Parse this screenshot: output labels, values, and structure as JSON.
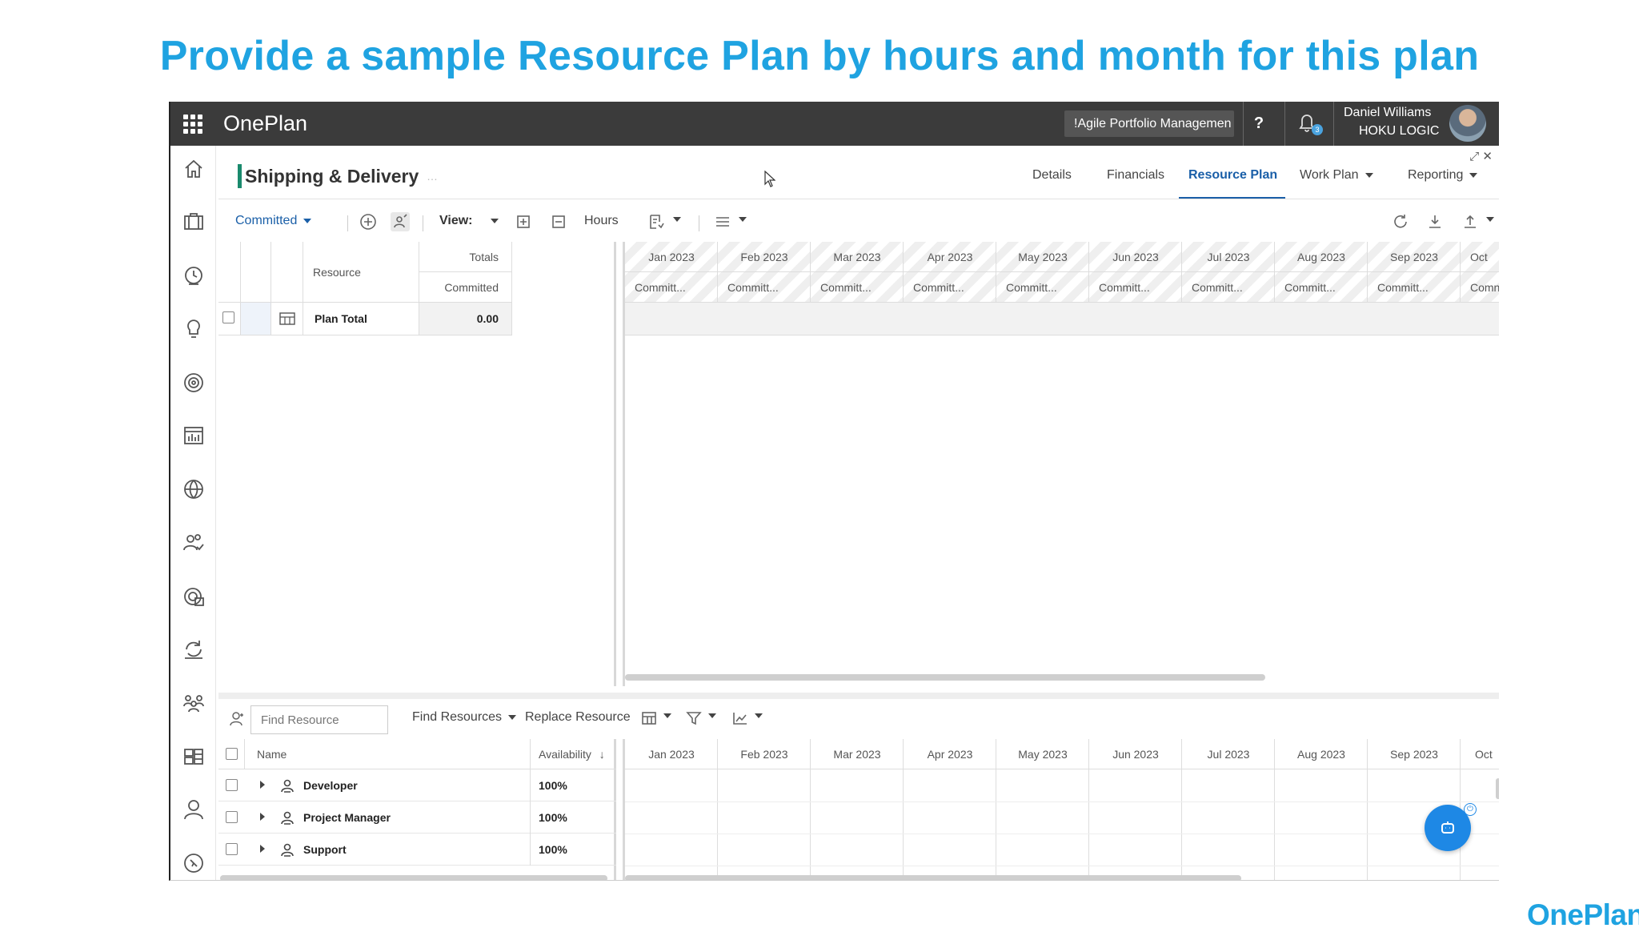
{
  "slide": {
    "title": "Provide a sample Resource Plan by hours and month for this plan",
    "footer_logo": "OnePlan"
  },
  "topbar": {
    "brand": "OnePlan",
    "portfolio": "!Agile Portfolio Managemen",
    "help": "?",
    "notifications_count": "3",
    "user_name": "Daniel Williams",
    "user_org": "HOKU LOGIC"
  },
  "sidenav": {
    "items": [
      "home-icon",
      "portfolio-icon",
      "timesheet-icon",
      "ideas-icon",
      "goals-icon",
      "reports-icon",
      "globe-icon",
      "resources-icon",
      "analytics-icon",
      "cycle-icon",
      "teams-icon",
      "boards-icon",
      "profile-icon",
      "compass-icon"
    ]
  },
  "project": {
    "title": "Shipping & Delivery",
    "dots": "…"
  },
  "tabs": {
    "details": "Details",
    "financials": "Financials",
    "resource_plan": "Resource Plan",
    "work_plan": "Work Plan",
    "reporting": "Reporting"
  },
  "toolbar": {
    "committed": "Committed",
    "view_label": "View:",
    "hours": "Hours"
  },
  "grid": {
    "resource_header": "Resource",
    "totals_header": "Totals",
    "committed_header": "Committed",
    "plan_total_label": "Plan Total",
    "plan_total_value": "0.00",
    "months": [
      "Jan 2023",
      "Feb 2023",
      "Mar 2023",
      "Apr 2023",
      "May 2023",
      "Jun 2023",
      "Jul 2023",
      "Aug 2023",
      "Sep 2023",
      "Oct"
    ],
    "month_sub": [
      "Committ...",
      "Committ...",
      "Committ...",
      "Committ...",
      "Committ...",
      "Committ...",
      "Committ...",
      "Committ...",
      "Committ...",
      "Comn"
    ]
  },
  "finder": {
    "placeholder": "Find Resource",
    "find_resources": "Find Resources",
    "replace_resource": "Replace Resource"
  },
  "lower_grid": {
    "name_header": "Name",
    "availability_header": "Availability",
    "months": [
      "Jan 2023",
      "Feb 2023",
      "Mar 2023",
      "Apr 2023",
      "May 2023",
      "Jun 2023",
      "Jul 2023",
      "Aug 2023",
      "Sep 2023",
      "Oct"
    ],
    "rows": [
      {
        "name": "Developer",
        "availability": "100%"
      },
      {
        "name": "Project Manager",
        "availability": "100%"
      },
      {
        "name": "Support",
        "availability": "100%"
      }
    ]
  }
}
